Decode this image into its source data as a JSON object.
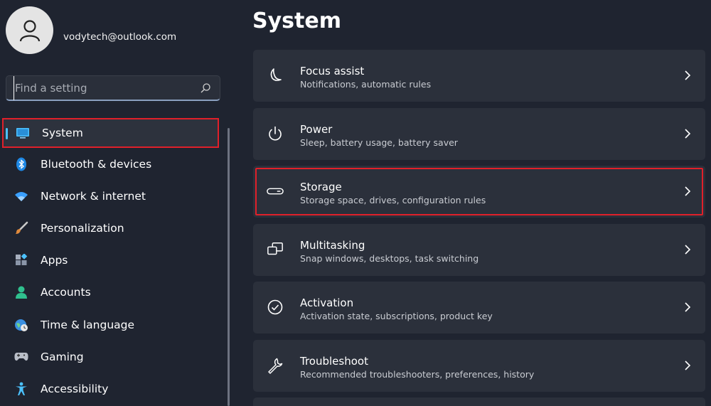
{
  "user": {
    "email": "vodytech@outlook.com"
  },
  "search": {
    "placeholder": "Find a setting",
    "value": ""
  },
  "sidebar": {
    "items": [
      {
        "label": "System",
        "icon": "display-icon",
        "selected": true
      },
      {
        "label": "Bluetooth & devices",
        "icon": "bluetooth-icon"
      },
      {
        "label": "Network & internet",
        "icon": "wifi-icon"
      },
      {
        "label": "Personalization",
        "icon": "brush-icon"
      },
      {
        "label": "Apps",
        "icon": "apps-icon"
      },
      {
        "label": "Accounts",
        "icon": "person-icon"
      },
      {
        "label": "Time & language",
        "icon": "globe-clock-icon"
      },
      {
        "label": "Gaming",
        "icon": "gamepad-icon"
      },
      {
        "label": "Accessibility",
        "icon": "accessibility-icon"
      }
    ]
  },
  "main": {
    "title": "System",
    "cards": [
      {
        "title": "Focus assist",
        "subtitle": "Notifications, automatic rules",
        "icon": "moon-icon"
      },
      {
        "title": "Power",
        "subtitle": "Sleep, battery usage, battery saver",
        "icon": "power-icon"
      },
      {
        "title": "Storage",
        "subtitle": "Storage space, drives, configuration rules",
        "icon": "storage-icon",
        "highlighted": true
      },
      {
        "title": "Multitasking",
        "subtitle": "Snap windows, desktops, task switching",
        "icon": "multitask-icon"
      },
      {
        "title": "Activation",
        "subtitle": "Activation state, subscriptions, product key",
        "icon": "check-circle-icon"
      },
      {
        "title": "Troubleshoot",
        "subtitle": "Recommended troubleshooters, preferences, history",
        "icon": "wrench-icon"
      }
    ]
  },
  "colors": {
    "background": "#1f2430",
    "card": "#2b303b",
    "accent": "#4cc2ff",
    "highlight_border": "#e0202a"
  }
}
